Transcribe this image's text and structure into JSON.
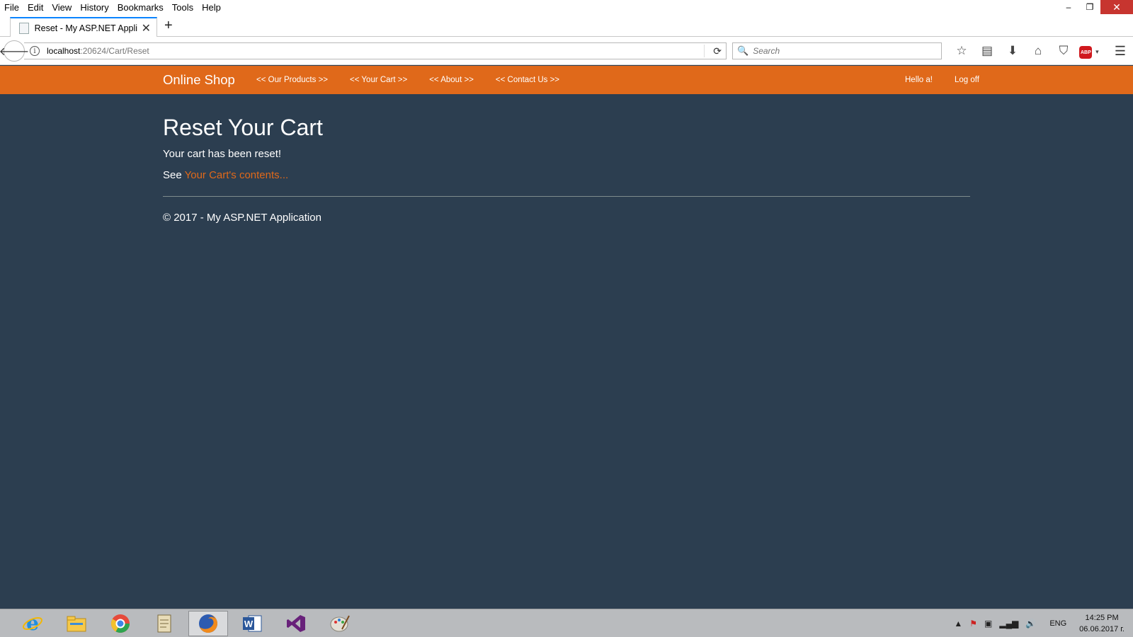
{
  "browser": {
    "menu": [
      "File",
      "Edit",
      "View",
      "History",
      "Bookmarks",
      "Tools",
      "Help"
    ],
    "window_controls": {
      "minimize": "–",
      "restore": "❐",
      "close": "✕"
    },
    "tab": {
      "title": "Reset - My ASP.NET Applica",
      "close": "✕"
    },
    "new_tab": "+",
    "back": "🡐",
    "url": {
      "host": "localhost",
      "rest": ":20624/Cart/Reset"
    },
    "reload": "⟳",
    "search_placeholder": "Search",
    "search_icon": "🔍",
    "toolbar_icons": [
      "☆",
      "▤",
      "⬇",
      "⌂",
      "⛉"
    ],
    "abp_label": "ABP",
    "menu_icon": "☰"
  },
  "site": {
    "brand": "Online Shop",
    "nav": [
      "<< Our Products >>",
      "<< Your Cart >>",
      "<< About >>",
      "<< Contact Us >>"
    ],
    "user_greeting": "Hello a!",
    "logoff": "Log off",
    "accent": "#e0691a",
    "background": "#2c3e50"
  },
  "main": {
    "title": "Reset Your Cart",
    "message": "Your cart has been reset!",
    "see_prefix": "See",
    "cart_link": "Your Cart's contents...",
    "footer": "© 2017 - My ASP.NET Application"
  },
  "taskbar": {
    "apps": [
      "internet-explorer",
      "file-explorer",
      "chrome-like",
      "notepad",
      "firefox",
      "word",
      "visual-studio",
      "paint"
    ],
    "lang": "ENG",
    "time": "14:25 PM",
    "date": "06.06.2017 г."
  }
}
